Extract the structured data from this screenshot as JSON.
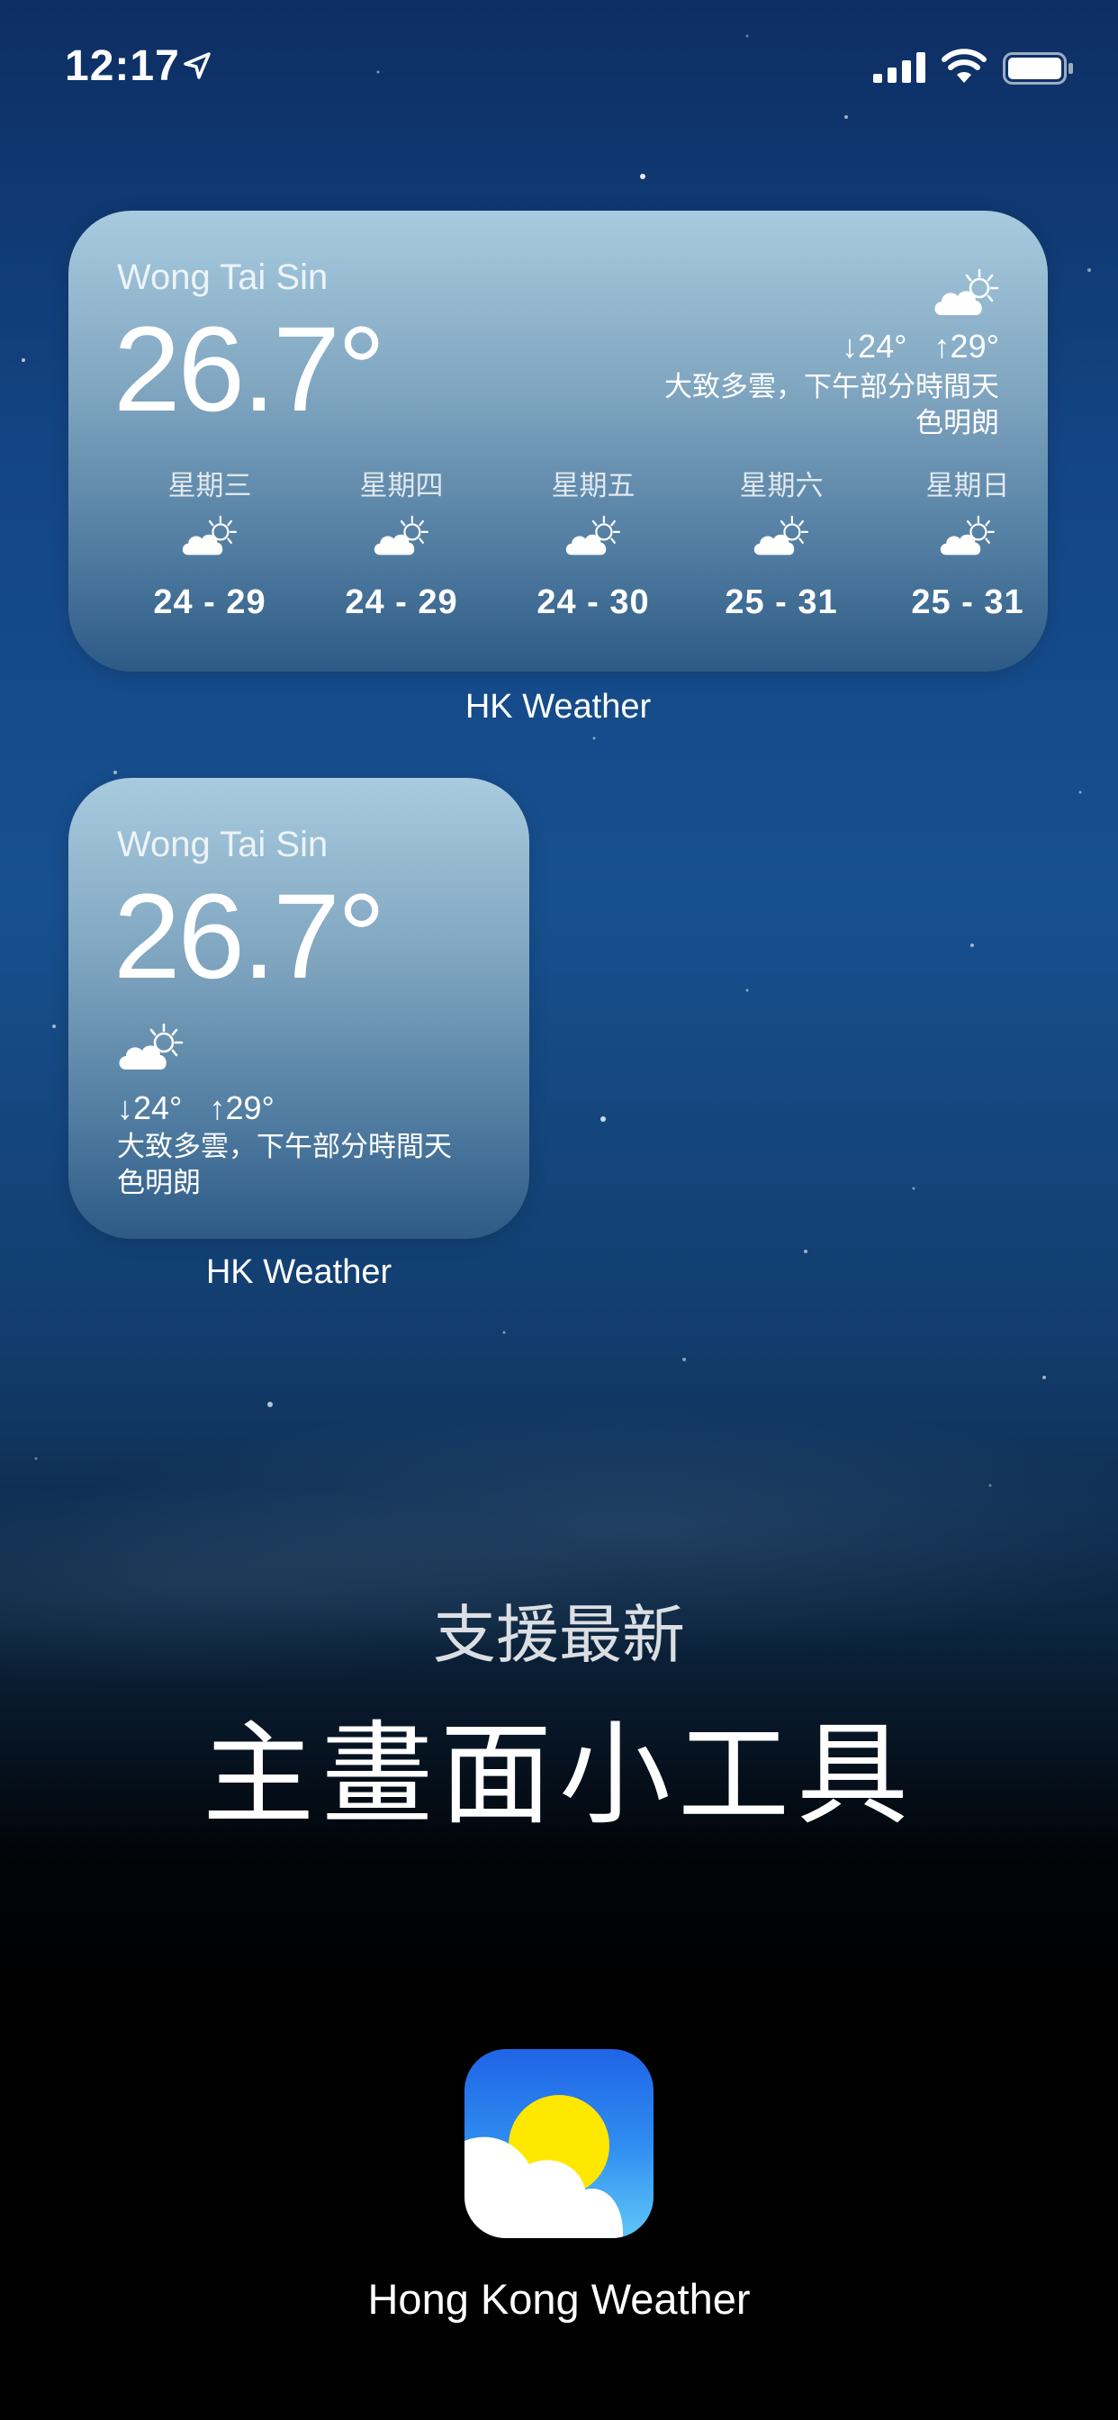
{
  "status_bar": {
    "time": "12:17",
    "icons": [
      "location-arrow-icon",
      "cellular-signal-icon",
      "wifi-icon",
      "battery-icon"
    ]
  },
  "widget_large": {
    "location": "Wong Tai Sin",
    "temperature": "26.7°",
    "icon": "partly-cloudy-icon",
    "low": "↓24°",
    "high": "↑29°",
    "description_line1": "大致多雲，下午部分時間天",
    "description_line2": "色明朗",
    "forecast": [
      {
        "day": "星期三",
        "icon": "partly-cloudy-icon",
        "range": "24 - 29"
      },
      {
        "day": "星期四",
        "icon": "partly-cloudy-icon",
        "range": "24 - 29"
      },
      {
        "day": "星期五",
        "icon": "partly-cloudy-icon",
        "range": "24 - 30"
      },
      {
        "day": "星期六",
        "icon": "partly-cloudy-icon",
        "range": "25 - 31"
      },
      {
        "day": "星期日",
        "icon": "partly-cloudy-icon",
        "range": "25 - 31"
      }
    ],
    "app_label": "HK Weather"
  },
  "widget_small": {
    "location": "Wong Tai Sin",
    "temperature": "26.7°",
    "icon": "partly-cloudy-icon",
    "low": "↓24°",
    "high": "↑29°",
    "description_line1": "大致多雲，下午部分時間天",
    "description_line2": "色明朗",
    "app_label": "HK Weather"
  },
  "promo": {
    "line1": "支援最新",
    "line2": "主畫面小工具"
  },
  "app": {
    "name": "Hong Kong Weather",
    "icon": "sun-cloud-app-icon"
  },
  "colors": {
    "sky_top": "#0d2e63",
    "sky_mid": "#17508f",
    "widget_top": "#a8cbde",
    "widget_bottom": "#2d5a86",
    "app_icon_blue": "#1f64e6",
    "sun_yellow": "#ffe800"
  }
}
